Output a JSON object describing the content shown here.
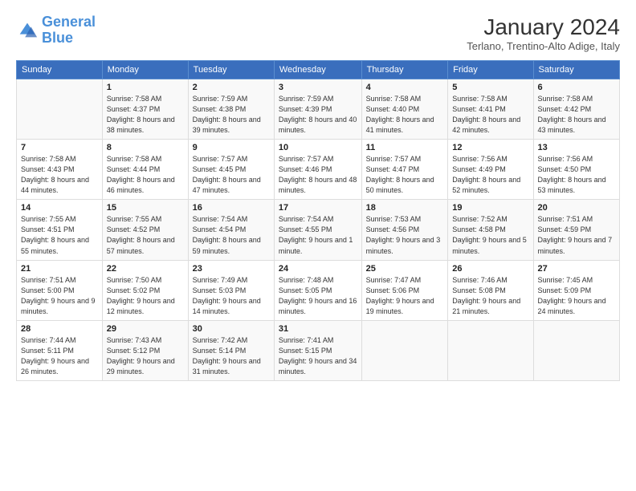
{
  "logo": {
    "line1": "General",
    "line2": "Blue"
  },
  "title": "January 2024",
  "subtitle": "Terlano, Trentino-Alto Adige, Italy",
  "days_header": [
    "Sunday",
    "Monday",
    "Tuesday",
    "Wednesday",
    "Thursday",
    "Friday",
    "Saturday"
  ],
  "weeks": [
    [
      {
        "num": "",
        "sunrise": "",
        "sunset": "",
        "daylight": ""
      },
      {
        "num": "1",
        "sunrise": "Sunrise: 7:58 AM",
        "sunset": "Sunset: 4:37 PM",
        "daylight": "Daylight: 8 hours and 38 minutes."
      },
      {
        "num": "2",
        "sunrise": "Sunrise: 7:59 AM",
        "sunset": "Sunset: 4:38 PM",
        "daylight": "Daylight: 8 hours and 39 minutes."
      },
      {
        "num": "3",
        "sunrise": "Sunrise: 7:59 AM",
        "sunset": "Sunset: 4:39 PM",
        "daylight": "Daylight: 8 hours and 40 minutes."
      },
      {
        "num": "4",
        "sunrise": "Sunrise: 7:58 AM",
        "sunset": "Sunset: 4:40 PM",
        "daylight": "Daylight: 8 hours and 41 minutes."
      },
      {
        "num": "5",
        "sunrise": "Sunrise: 7:58 AM",
        "sunset": "Sunset: 4:41 PM",
        "daylight": "Daylight: 8 hours and 42 minutes."
      },
      {
        "num": "6",
        "sunrise": "Sunrise: 7:58 AM",
        "sunset": "Sunset: 4:42 PM",
        "daylight": "Daylight: 8 hours and 43 minutes."
      }
    ],
    [
      {
        "num": "7",
        "sunrise": "Sunrise: 7:58 AM",
        "sunset": "Sunset: 4:43 PM",
        "daylight": "Daylight: 8 hours and 44 minutes."
      },
      {
        "num": "8",
        "sunrise": "Sunrise: 7:58 AM",
        "sunset": "Sunset: 4:44 PM",
        "daylight": "Daylight: 8 hours and 46 minutes."
      },
      {
        "num": "9",
        "sunrise": "Sunrise: 7:57 AM",
        "sunset": "Sunset: 4:45 PM",
        "daylight": "Daylight: 8 hours and 47 minutes."
      },
      {
        "num": "10",
        "sunrise": "Sunrise: 7:57 AM",
        "sunset": "Sunset: 4:46 PM",
        "daylight": "Daylight: 8 hours and 48 minutes."
      },
      {
        "num": "11",
        "sunrise": "Sunrise: 7:57 AM",
        "sunset": "Sunset: 4:47 PM",
        "daylight": "Daylight: 8 hours and 50 minutes."
      },
      {
        "num": "12",
        "sunrise": "Sunrise: 7:56 AM",
        "sunset": "Sunset: 4:49 PM",
        "daylight": "Daylight: 8 hours and 52 minutes."
      },
      {
        "num": "13",
        "sunrise": "Sunrise: 7:56 AM",
        "sunset": "Sunset: 4:50 PM",
        "daylight": "Daylight: 8 hours and 53 minutes."
      }
    ],
    [
      {
        "num": "14",
        "sunrise": "Sunrise: 7:55 AM",
        "sunset": "Sunset: 4:51 PM",
        "daylight": "Daylight: 8 hours and 55 minutes."
      },
      {
        "num": "15",
        "sunrise": "Sunrise: 7:55 AM",
        "sunset": "Sunset: 4:52 PM",
        "daylight": "Daylight: 8 hours and 57 minutes."
      },
      {
        "num": "16",
        "sunrise": "Sunrise: 7:54 AM",
        "sunset": "Sunset: 4:54 PM",
        "daylight": "Daylight: 8 hours and 59 minutes."
      },
      {
        "num": "17",
        "sunrise": "Sunrise: 7:54 AM",
        "sunset": "Sunset: 4:55 PM",
        "daylight": "Daylight: 9 hours and 1 minute."
      },
      {
        "num": "18",
        "sunrise": "Sunrise: 7:53 AM",
        "sunset": "Sunset: 4:56 PM",
        "daylight": "Daylight: 9 hours and 3 minutes."
      },
      {
        "num": "19",
        "sunrise": "Sunrise: 7:52 AM",
        "sunset": "Sunset: 4:58 PM",
        "daylight": "Daylight: 9 hours and 5 minutes."
      },
      {
        "num": "20",
        "sunrise": "Sunrise: 7:51 AM",
        "sunset": "Sunset: 4:59 PM",
        "daylight": "Daylight: 9 hours and 7 minutes."
      }
    ],
    [
      {
        "num": "21",
        "sunrise": "Sunrise: 7:51 AM",
        "sunset": "Sunset: 5:00 PM",
        "daylight": "Daylight: 9 hours and 9 minutes."
      },
      {
        "num": "22",
        "sunrise": "Sunrise: 7:50 AM",
        "sunset": "Sunset: 5:02 PM",
        "daylight": "Daylight: 9 hours and 12 minutes."
      },
      {
        "num": "23",
        "sunrise": "Sunrise: 7:49 AM",
        "sunset": "Sunset: 5:03 PM",
        "daylight": "Daylight: 9 hours and 14 minutes."
      },
      {
        "num": "24",
        "sunrise": "Sunrise: 7:48 AM",
        "sunset": "Sunset: 5:05 PM",
        "daylight": "Daylight: 9 hours and 16 minutes."
      },
      {
        "num": "25",
        "sunrise": "Sunrise: 7:47 AM",
        "sunset": "Sunset: 5:06 PM",
        "daylight": "Daylight: 9 hours and 19 minutes."
      },
      {
        "num": "26",
        "sunrise": "Sunrise: 7:46 AM",
        "sunset": "Sunset: 5:08 PM",
        "daylight": "Daylight: 9 hours and 21 minutes."
      },
      {
        "num": "27",
        "sunrise": "Sunrise: 7:45 AM",
        "sunset": "Sunset: 5:09 PM",
        "daylight": "Daylight: 9 hours and 24 minutes."
      }
    ],
    [
      {
        "num": "28",
        "sunrise": "Sunrise: 7:44 AM",
        "sunset": "Sunset: 5:11 PM",
        "daylight": "Daylight: 9 hours and 26 minutes."
      },
      {
        "num": "29",
        "sunrise": "Sunrise: 7:43 AM",
        "sunset": "Sunset: 5:12 PM",
        "daylight": "Daylight: 9 hours and 29 minutes."
      },
      {
        "num": "30",
        "sunrise": "Sunrise: 7:42 AM",
        "sunset": "Sunset: 5:14 PM",
        "daylight": "Daylight: 9 hours and 31 minutes."
      },
      {
        "num": "31",
        "sunrise": "Sunrise: 7:41 AM",
        "sunset": "Sunset: 5:15 PM",
        "daylight": "Daylight: 9 hours and 34 minutes."
      },
      {
        "num": "",
        "sunrise": "",
        "sunset": "",
        "daylight": ""
      },
      {
        "num": "",
        "sunrise": "",
        "sunset": "",
        "daylight": ""
      },
      {
        "num": "",
        "sunrise": "",
        "sunset": "",
        "daylight": ""
      }
    ]
  ]
}
